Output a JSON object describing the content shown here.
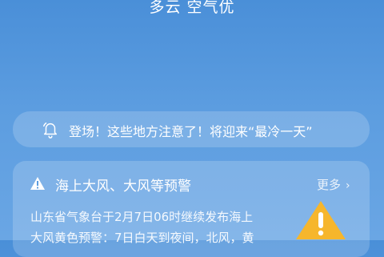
{
  "weather": {
    "condition": "多云 空气优"
  },
  "notice": {
    "icon": "bell-icon",
    "text": "登场！这些地方注意了！将迎来“最冷一天”"
  },
  "warning_card": {
    "icon": "warning-triangle-icon",
    "title": "海上大风、大风等预警",
    "more_label": "更多",
    "more_icon": "chevron-right-icon",
    "body_line1": "山东省气象台于2月7日06时继续发布海上",
    "body_line2": "大风黄色预警：7日白天到夜间，北风，黄",
    "level_icon": "yellow-warning-icon",
    "level_color": "#f6b62c"
  }
}
